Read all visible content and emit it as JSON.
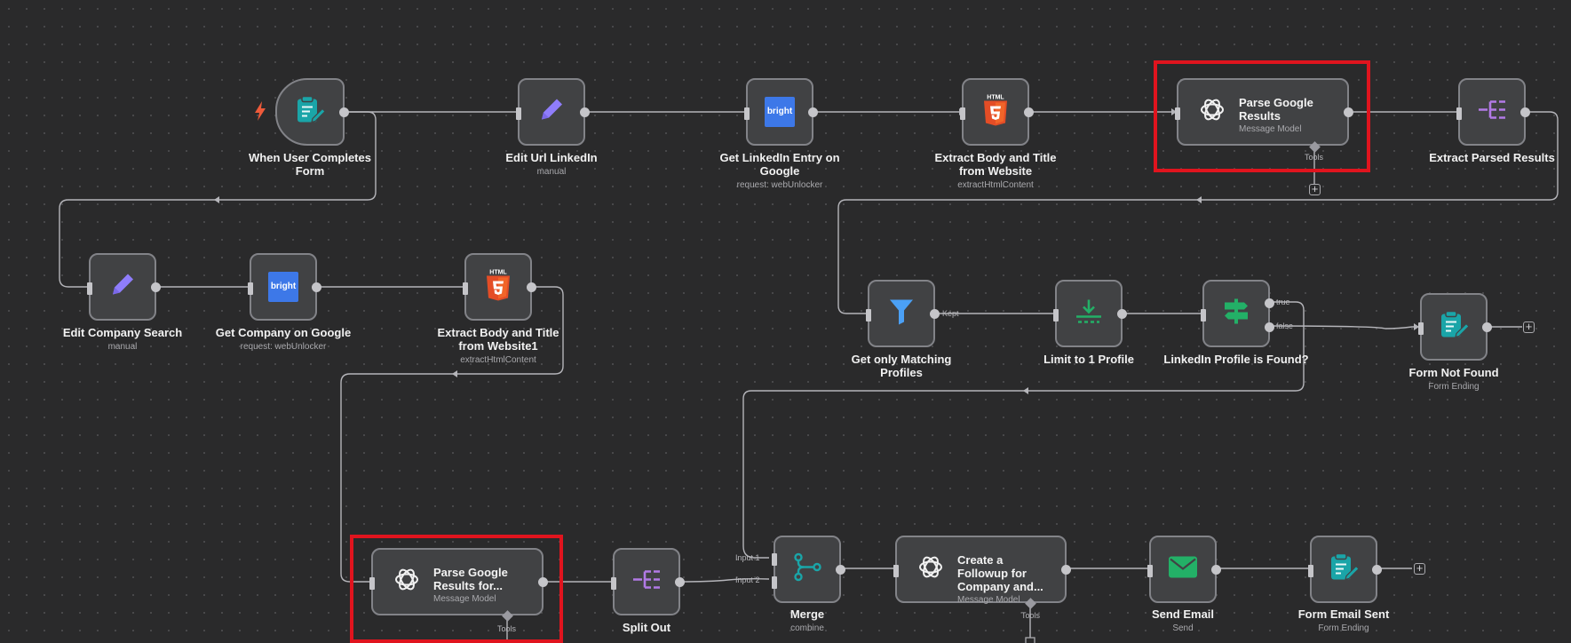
{
  "nodes": {
    "form_trigger": {
      "title": "When User Completes Form",
      "subtitle": ""
    },
    "edit_url": {
      "title": "Edit Url LinkedIn",
      "subtitle": "manual"
    },
    "get_linkedin": {
      "title": "Get LinkedIn Entry on Google",
      "subtitle": "request: webUnlocker",
      "icon_text": "bright"
    },
    "extract_body": {
      "title": "Extract Body and Title from Website",
      "subtitle": "extractHtmlContent",
      "badge": "HTML"
    },
    "parse_results": {
      "title": "Parse Google Results",
      "subtitle": "Message Model",
      "tools": "Tools"
    },
    "extract_parsed": {
      "title": "Extract Parsed Results",
      "subtitle": ""
    },
    "edit_company": {
      "title": "Edit Company Search",
      "subtitle": "manual"
    },
    "get_company": {
      "title": "Get Company on Google",
      "subtitle": "request: webUnlocker",
      "icon_text": "bright"
    },
    "extract_body1": {
      "title": "Extract Body and Title from Website1",
      "subtitle": "extractHtmlContent",
      "badge": "HTML"
    },
    "get_matching": {
      "title": "Get only Matching Profiles",
      "subtitle": "",
      "port_label": "Kept"
    },
    "limit_profile": {
      "title": "Limit to 1 Profile",
      "subtitle": ""
    },
    "profile_found": {
      "title": "LinkedIn Profile is Found?",
      "subtitle": "",
      "true_label": "true",
      "false_label": "false"
    },
    "form_not_found": {
      "title": "Form Not Found",
      "subtitle": "Form Ending"
    },
    "parse_results_for": {
      "title": "Parse Google Results for...",
      "subtitle": "Message Model",
      "tools": "Tools"
    },
    "split_out": {
      "title": "Split Out",
      "subtitle": ""
    },
    "merge": {
      "title": "Merge",
      "subtitle": "combine",
      "input1": "Input 1",
      "input2": "Input 2"
    },
    "create_followup": {
      "title": "Create a Followup for Company and...",
      "subtitle": "Message Model",
      "tools": "Tools"
    },
    "send_email": {
      "title": "Send Email",
      "subtitle": "Send"
    },
    "form_email_sent": {
      "title": "Form Email Sent",
      "subtitle": "Form Ending"
    }
  },
  "colors": {
    "canvas": "#2a2a2b",
    "node_bg": "#414244",
    "node_border": "#828388",
    "edge": "#b5b5ba",
    "highlight": "#e0141e",
    "teal": "#1aa5a8",
    "purple": "#8f7dfb",
    "html_orange": "#e44d26",
    "bright_blue": "#3d78e8",
    "filter_blue": "#4ba0f5",
    "green": "#23b067",
    "split_purple": "#b27ae6"
  }
}
